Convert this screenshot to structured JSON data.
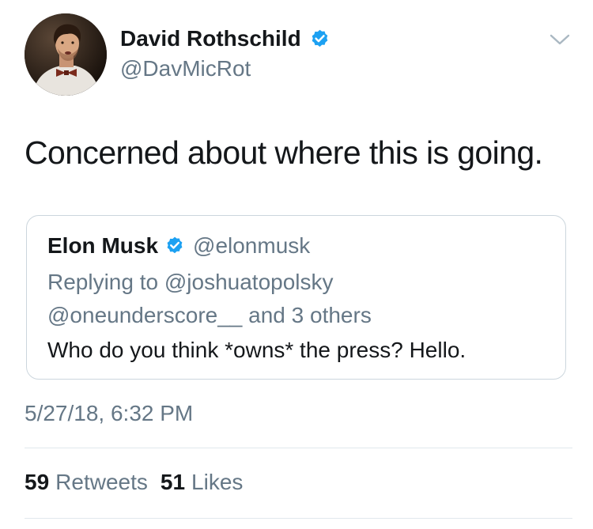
{
  "author": {
    "name": "David Rothschild",
    "handle": "@DavMicRot",
    "verified": true,
    "avatar_icon": "profile-photo"
  },
  "tweet": {
    "text": "Concerned about where this is going.",
    "timestamp": "5/27/18, 6:32 PM",
    "menu_icon": "chevron-down-icon"
  },
  "quoted_tweet": {
    "author_name": "Elon Musk",
    "author_handle": "@elonmusk",
    "verified": true,
    "reply_line_1": "Replying to @joshuatopolsky",
    "reply_line_2": "@oneunderscore__ and 3 others",
    "text": "Who do you think *owns* the press? Hello."
  },
  "stats": {
    "retweets_count": "59",
    "retweets_label": "Retweets",
    "likes_count": "51",
    "likes_label": "Likes"
  },
  "colors": {
    "verified_blue": "#1da1f2",
    "secondary_text": "#657786",
    "primary_text": "#14171a",
    "border": "#ccd6dd"
  }
}
